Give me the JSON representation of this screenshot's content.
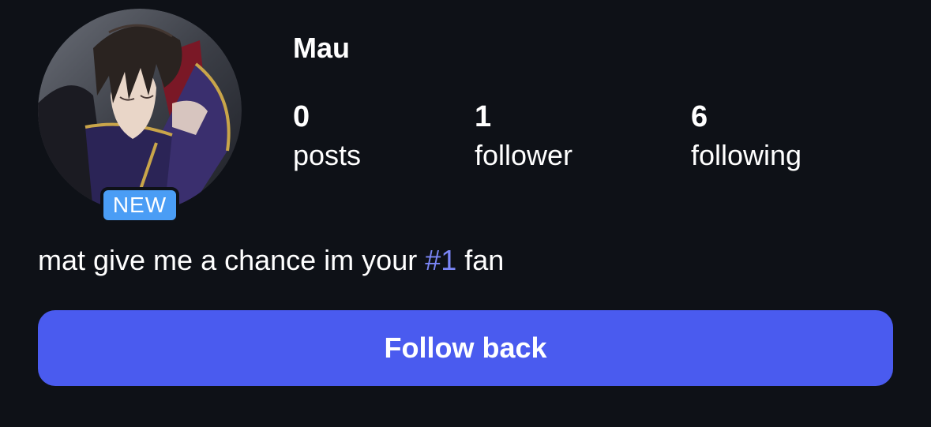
{
  "profile": {
    "username": "Mau",
    "avatar": "anime-character-avatar",
    "badge": "NEW",
    "bio_prefix": "mat give me a chance im your ",
    "bio_tag": "#1",
    "bio_suffix": " fan"
  },
  "stats": [
    {
      "value": "0",
      "label": "posts"
    },
    {
      "value": "1",
      "label": "follower"
    },
    {
      "value": "6",
      "label": "following"
    }
  ],
  "actions": {
    "follow_back_label": "Follow back"
  },
  "colors": {
    "background": "#0e1117",
    "button": "#4a5bef",
    "badge": "#4a9df5",
    "link": "#7b86f7"
  }
}
